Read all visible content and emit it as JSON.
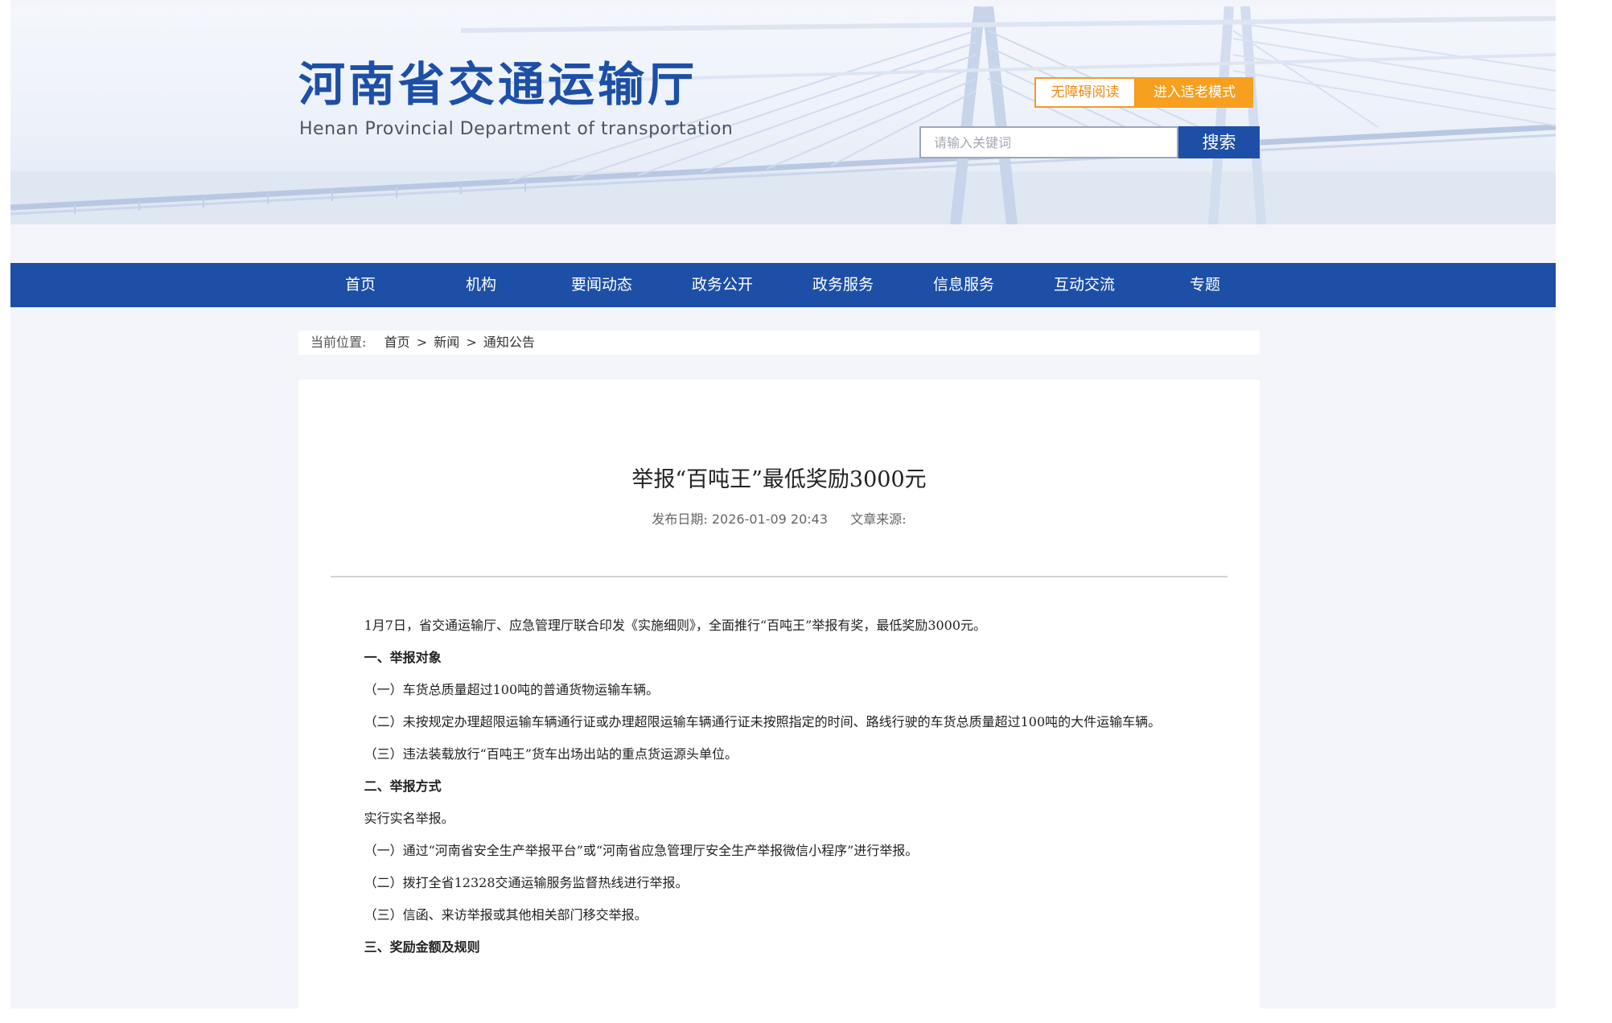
{
  "header": {
    "title": "河南省交通运输厅",
    "subtitle": "Henan Provincial Department of transportation",
    "accessible_label": "无障碍阅读",
    "elderly_label": "进入适老模式",
    "search_placeholder": "请输入关键词",
    "search_button": "搜索"
  },
  "nav": {
    "items": [
      {
        "label": "首页"
      },
      {
        "label": "机构"
      },
      {
        "label": "要闻动态"
      },
      {
        "label": "政务公开"
      },
      {
        "label": "政务服务"
      },
      {
        "label": "信息服务"
      },
      {
        "label": "互动交流"
      },
      {
        "label": "专题"
      }
    ]
  },
  "breadcrumb": {
    "label": "当前位置:",
    "items": [
      "首页",
      "新闻",
      "通知公告"
    ],
    "separator": ">"
  },
  "article": {
    "title": "举报“百吨王”最低奖励3000元",
    "date_label": "发布日期:",
    "date": "2026-01-09 20:43",
    "source_label": "文章来源:",
    "paragraphs": [
      "1月7日，省交通运输厅、应急管理厅联合印发《实施细则》，全面推行“百吨王”举报有奖，最低奖励3000元。",
      "一、举报对象",
      "（一）车货总质量超过100吨的普通货物运输车辆。",
      "（二）未按规定办理超限运输车辆通行证或办理超限运输车辆通行证未按照指定的时间、路线行驶的车货总质量超过100吨的大件运输车辆。",
      "（三）违法装载放行“百吨王”货车出场出站的重点货运源头单位。",
      "二、举报方式",
      "实行实名举报。",
      "（一）通过“河南省安全生产举报平台”或“河南省应急管理厅安全生产举报微信小程序”进行举报。",
      "（二）拨打全省12328交通运输服务监督热线进行举报。",
      "（三）信函、来访举报或其他相关部门移交举报。",
      "三、奖励金额及规则"
    ]
  },
  "colors": {
    "brand_blue": "#1d4fa6",
    "accent_orange": "#f7a01f",
    "page_background": "#f3f5fa"
  }
}
